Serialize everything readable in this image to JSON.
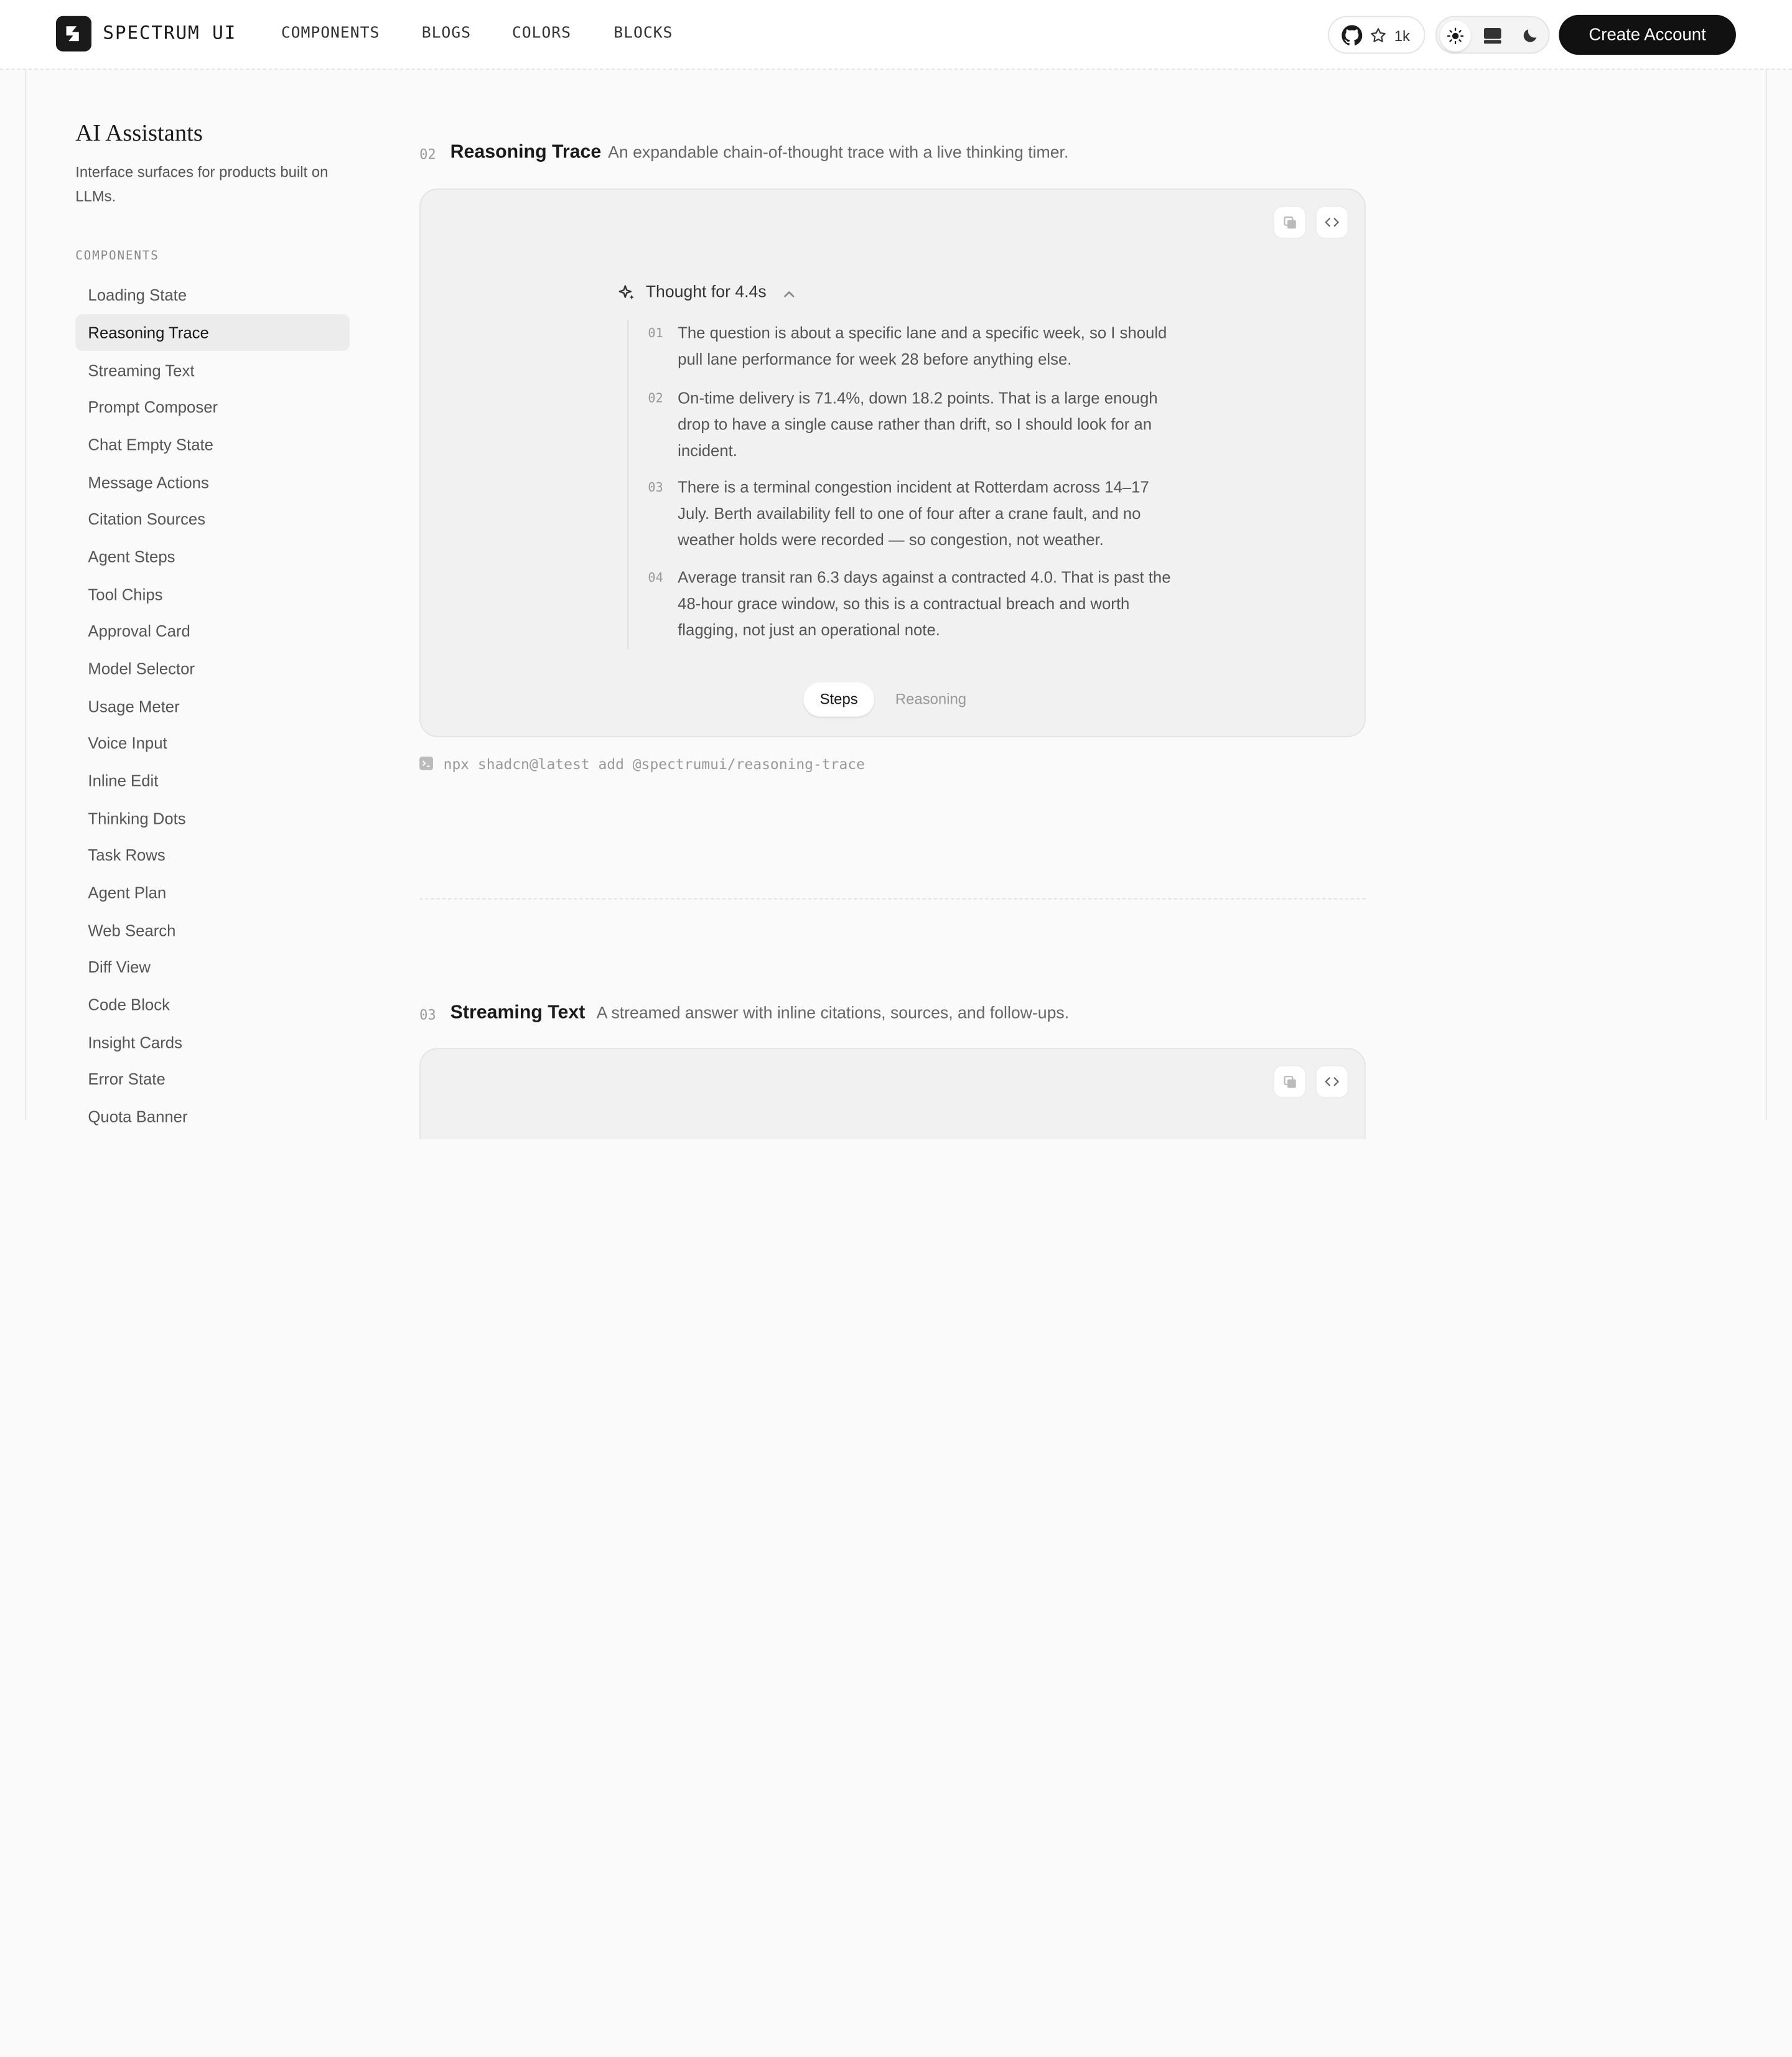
{
  "header": {
    "brand": "SPECTRUM UI",
    "nav": [
      "COMPONENTS",
      "BLOGS",
      "COLORS",
      "BLOCKS"
    ],
    "github_stars": "1k",
    "create_account": "Create Account"
  },
  "sidebar": {
    "title": "AI Assistants",
    "description": "Interface surfaces for products built on LLMs.",
    "section_label": "COMPONENTS",
    "items": [
      {
        "label": "Loading State"
      },
      {
        "label": "Reasoning Trace"
      },
      {
        "label": "Streaming Text"
      },
      {
        "label": "Prompt Composer"
      },
      {
        "label": "Chat Empty State"
      },
      {
        "label": "Message Actions"
      },
      {
        "label": "Citation Sources"
      },
      {
        "label": "Agent Steps"
      },
      {
        "label": "Tool Chips"
      },
      {
        "label": "Approval Card"
      },
      {
        "label": "Model Selector"
      },
      {
        "label": "Usage Meter"
      },
      {
        "label": "Voice Input"
      },
      {
        "label": "Inline Edit"
      },
      {
        "label": "Thinking Dots"
      },
      {
        "label": "Task Rows"
      },
      {
        "label": "Agent Plan"
      },
      {
        "label": "Web Search"
      },
      {
        "label": "Diff View"
      },
      {
        "label": "Code Block"
      },
      {
        "label": "Insight Cards"
      },
      {
        "label": "Error State"
      },
      {
        "label": "Quota Banner"
      }
    ],
    "active_item": "Reasoning Trace"
  },
  "sections": [
    {
      "number": "02",
      "title": "Reasoning Trace",
      "description": "An expandable chain-of-thought trace with a live thinking timer.",
      "thought_label": "Thought for 4.4s",
      "steps": [
        {
          "num": "01",
          "text": "The question is about a specific lane and a specific week, so I should pull lane performance for week 28 before anything else."
        },
        {
          "num": "02",
          "text": "On-time delivery is 71.4%, down 18.2 points. That is a large enough drop to have a single cause rather than drift, so I should look for an incident."
        },
        {
          "num": "03",
          "text": "There is a terminal congestion incident at Rotterdam across 14–17 July. Berth availability fell to one of four after a crane fault, and no weather holds were recorded — so congestion, not weather."
        },
        {
          "num": "04",
          "text": "Average transit ran 6.3 days against a contracted 4.0. That is past the 48-hour grace window, so this is a contractual breach and worth flagging, not just an operational note."
        }
      ],
      "tabs": [
        "Steps",
        "Reasoning"
      ],
      "active_tab": "Steps",
      "install_command": "npx shadcn@latest add @spectrumui/reasoning-trace"
    },
    {
      "number": "03",
      "title": "Streaming Text",
      "description": "A streamed answer with inline citations, sources, and follow-ups."
    }
  ]
}
